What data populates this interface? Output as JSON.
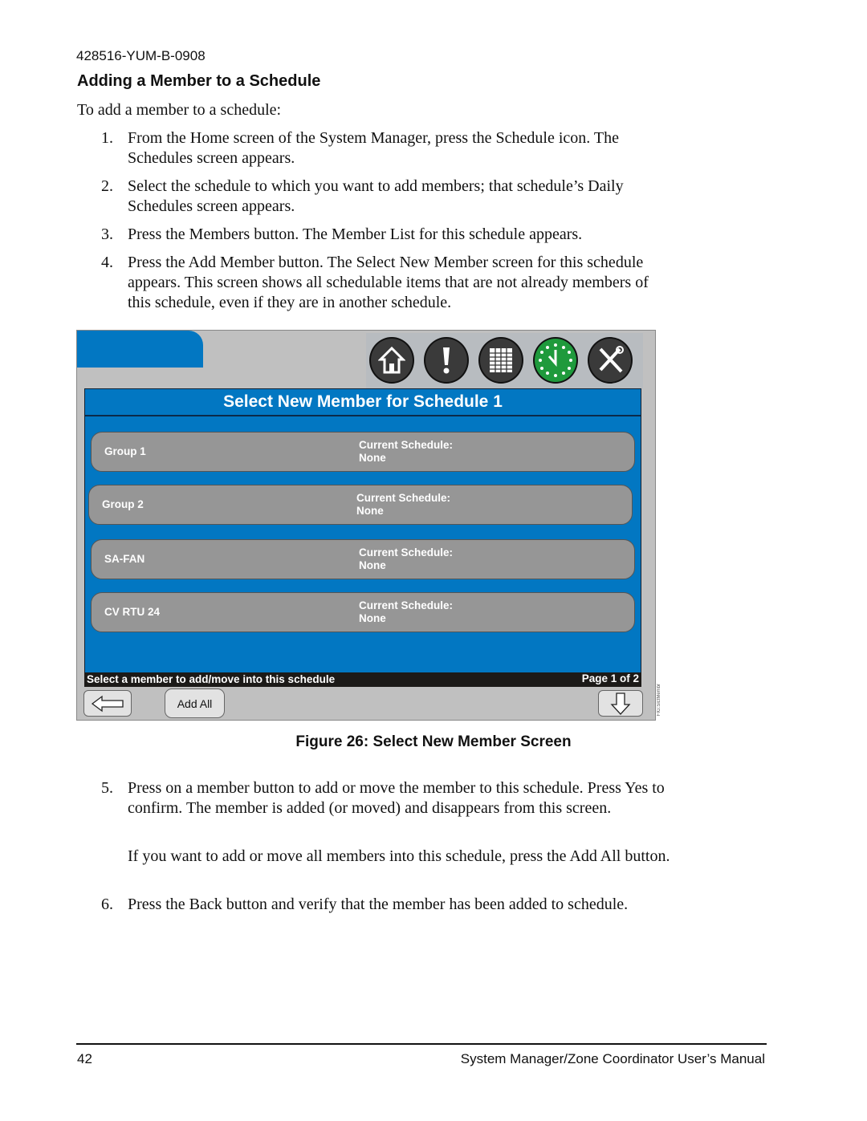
{
  "header": {
    "doc_id": "428516-YUM-B-0908"
  },
  "section": {
    "title": "Adding a Member to a Schedule",
    "intro": "To add a member to a schedule:"
  },
  "steps_before": [
    {
      "num": "1.",
      "text": "From the Home screen of the System Manager, press the Schedule icon. The Schedules screen appears."
    },
    {
      "num": "2.",
      "text": "Select the schedule to which you want to add members; that schedule’s Daily Schedules screen appears."
    },
    {
      "num": "3.",
      "text": "Press the Members button. The Member List for this schedule appears."
    },
    {
      "num": "4.",
      "text": "Press the Add Member button. The Select New Member screen for this schedule appears. This screen shows all schedulable items that are not already members of this schedule, even if they are in another schedule."
    }
  ],
  "screen": {
    "icons": [
      "home-icon",
      "alarm-icon",
      "report-icon",
      "schedule-clock-icon",
      "tools-icon"
    ],
    "title": "Select New Member for Schedule 1",
    "members": [
      {
        "name": "Group 1",
        "schedule_label": "Current Schedule:",
        "schedule_value": "None"
      },
      {
        "name": "Group 2",
        "schedule_label": "Current Schedule:",
        "schedule_value": "None"
      },
      {
        "name": "SA-FAN",
        "schedule_label": "Current Schedule:",
        "schedule_value": "None"
      },
      {
        "name": "CV RTU 24",
        "schedule_label": "Current Schedule:",
        "schedule_value": "None"
      }
    ],
    "status": "Select a member to add/move into this schedule",
    "page": "Page 1 of 2",
    "add_all": "Add All",
    "fig_tag": "FIG:SlctMembr",
    "colors": {
      "blue": "#0277c2",
      "gray": "#c0c0c0",
      "button": "#969696",
      "clock_green": "#1f9a3c"
    }
  },
  "figure_caption": "Figure 26: Select New Member Screen",
  "steps_after": [
    {
      "num": "5.",
      "text": "Press on a member button to add or move the member to this schedule. Press Yes to confirm. The member is added (or moved) and disappears from this screen."
    },
    {
      "num": "",
      "text": "If you want to add or move all members into this schedule, press the Add All button."
    },
    {
      "num": "6.",
      "text": "Press the Back button and verify that the member has been added to schedule."
    }
  ],
  "footer": {
    "page_number": "42",
    "manual_title": "System Manager/Zone Coordinator User’s Manual"
  }
}
